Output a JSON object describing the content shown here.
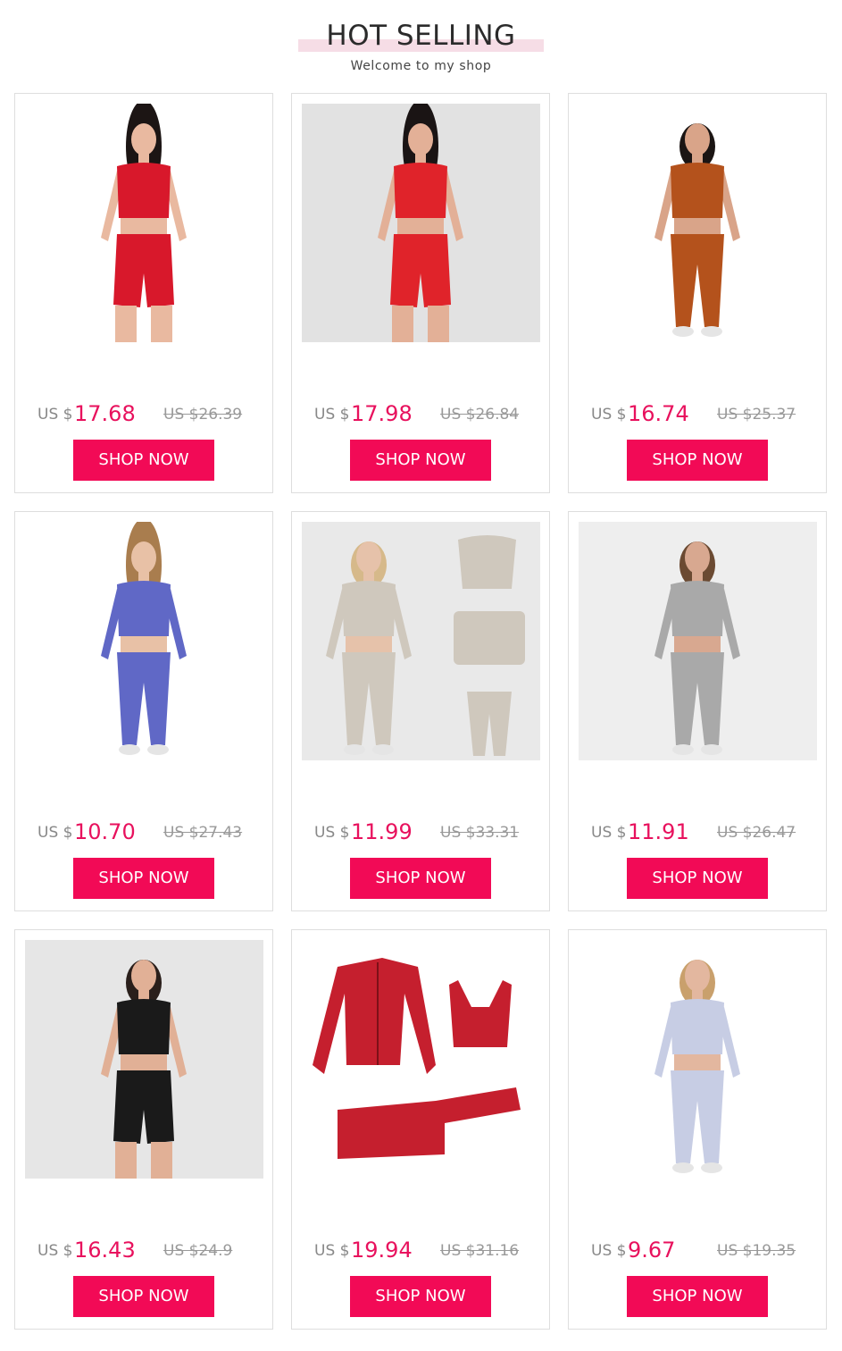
{
  "header": {
    "title": "HOT SELLING",
    "subtitle": "Welcome to my shop"
  },
  "products": [
    {
      "currency": "US $",
      "price": "17.68",
      "old_price": "US $26.39",
      "button": "SHOP NOW",
      "image": "model-red-sports-bra-shorts",
      "colors": {
        "bg": "#ffffff",
        "garment": "#d8182b",
        "skin": "#e9b9a0",
        "hair": "#1c1514"
      }
    },
    {
      "currency": "US $",
      "price": "17.98",
      "old_price": "US $26.84",
      "button": "SHOP NOW",
      "image": "model-red-set-white-shirt",
      "colors": {
        "bg": "#e2e2e2",
        "garment": "#e0232a",
        "skin": "#e3b097",
        "hair": "#1a1414"
      }
    },
    {
      "currency": "US $",
      "price": "16.74",
      "old_price": "US $25.37",
      "button": "SHOP NOW",
      "image": "model-rust-leggings-set",
      "colors": {
        "bg": "#ffffff",
        "garment": "#b4521c",
        "skin": "#d9a489",
        "hair": "#1b1514"
      }
    },
    {
      "currency": "US $",
      "price": "10.70",
      "old_price": "US $27.43",
      "button": "SHOP NOW",
      "image": "model-purple-long-sleeve-set",
      "colors": {
        "bg": "#ffffff",
        "garment": "#6068c6",
        "skin": "#e8c1a6",
        "hair": "#a97d4e"
      }
    },
    {
      "currency": "US $",
      "price": "11.99",
      "old_price": "US $33.31",
      "button": "SHOP NOW",
      "image": "model-beige-set-collage",
      "colors": {
        "bg": "#e9e9e9",
        "garment": "#cfc8bd",
        "skin": "#e6c2aa",
        "hair": "#d6b98a"
      }
    },
    {
      "currency": "US $",
      "price": "11.91",
      "old_price": "US $26.47",
      "button": "SHOP NOW",
      "image": "model-grey-striped-top-back",
      "colors": {
        "bg": "#eeeeee",
        "garment": "#a9a9a9",
        "skin": "#d8a890",
        "hair": "#6b4a32"
      }
    },
    {
      "currency": "US $",
      "price": "16.43",
      "old_price": "US $24.9",
      "button": "SHOP NOW",
      "image": "model-black-tank-shorts",
      "colors": {
        "bg": "#e6e6e6",
        "garment": "#1a1a1a",
        "skin": "#e1b096",
        "hair": "#2a1f1b"
      }
    },
    {
      "currency": "US $",
      "price": "19.94",
      "old_price": "US $31.16",
      "button": "SHOP NOW",
      "image": "red-three-piece-flatlay",
      "colors": {
        "bg": "#ffffff",
        "garment": "#c51f2e",
        "skin": "#ffffff",
        "hair": "#ffffff"
      }
    },
    {
      "currency": "US $",
      "price": "9.67",
      "old_price": "US $19.35",
      "button": "SHOP NOW",
      "image": "model-lightblue-zip-jacket-set",
      "colors": {
        "bg": "#ffffff",
        "garment": "#c7cde4",
        "skin": "#e3b79f",
        "hair": "#c9a06c"
      }
    }
  ]
}
